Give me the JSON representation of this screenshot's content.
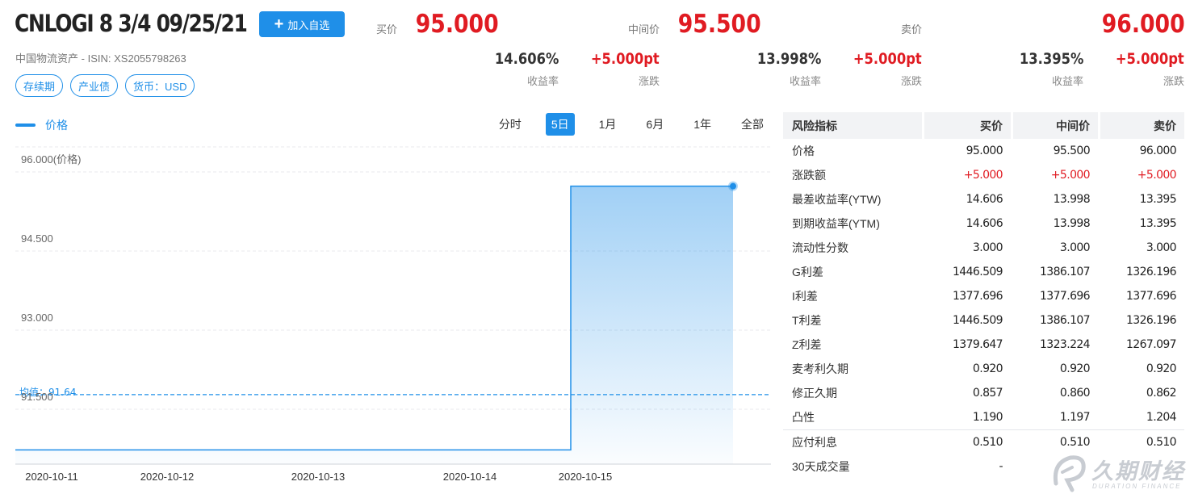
{
  "header": {
    "bond_name": "CNLOGI 8 3/4 09/25/21",
    "add_button_label": "加入自选",
    "issuer": "中国物流资产",
    "isin_label": "ISIN:",
    "isin": "XS2055798263",
    "tags": [
      "存续期",
      "产业债",
      "货币：USD"
    ]
  },
  "quotes": [
    {
      "label": "买价",
      "price": "95.000",
      "yield": "14.606%",
      "yield_label": "收益率",
      "change": "+5.000pt",
      "change_label": "涨跌"
    },
    {
      "label": "中间价",
      "price": "95.500",
      "yield": "13.998%",
      "yield_label": "收益率",
      "change": "+5.000pt",
      "change_label": "涨跌"
    },
    {
      "label": "卖价",
      "price": "96.000",
      "yield": "13.395%",
      "yield_label": "收益率",
      "change": "+5.000pt",
      "change_label": "涨跌"
    }
  ],
  "chart_controls": {
    "legend_label": "价格",
    "periods": [
      "分时",
      "5日",
      "1月",
      "6月",
      "1年",
      "全部"
    ],
    "active_period": "5日"
  },
  "chart_data": {
    "type": "area",
    "series": [
      {
        "name": "价格",
        "x": [
          "2020-10-11",
          "2020-10-12",
          "2020-10-13",
          "2020-10-14",
          "2020-10-15",
          "2020-10-15",
          "2020-10-16"
        ],
        "values": [
          90.5,
          90.5,
          90.5,
          90.5,
          90.5,
          95.5,
          95.5
        ]
      }
    ],
    "x_tick_labels": [
      "2020-10-11",
      "2020-10-12",
      "2020-10-13",
      "2020-10-14",
      "2020-10-15"
    ],
    "y_tick_labels": [
      "96.000(价格)",
      "94.500",
      "93.000",
      "91.500"
    ],
    "y_ticks": [
      96.0,
      94.5,
      93.0,
      91.5
    ],
    "average": {
      "label": "均值：91.64",
      "value": 91.64
    },
    "grid": true,
    "color": "#1f8fe8"
  },
  "risk_table": {
    "headers": [
      "风险指标",
      "买价",
      "中间价",
      "卖价"
    ],
    "rows": [
      {
        "name": "价格",
        "values": [
          "95.000",
          "95.500",
          "96.000"
        ]
      },
      {
        "name": "涨跌额",
        "values": [
          "+5.000",
          "+5.000",
          "+5.000"
        ]
      },
      {
        "name": "最差收益率(YTW)",
        "values": [
          "14.606",
          "13.998",
          "13.395"
        ]
      },
      {
        "name": "到期收益率(YTM)",
        "values": [
          "14.606",
          "13.998",
          "13.395"
        ]
      },
      {
        "name": "流动性分数",
        "values": [
          "3.000",
          "3.000",
          "3.000"
        ]
      },
      {
        "name": "G利差",
        "values": [
          "1446.509",
          "1386.107",
          "1326.196"
        ]
      },
      {
        "name": "I利差",
        "values": [
          "1377.696",
          "1377.696",
          "1377.696"
        ]
      },
      {
        "name": "T利差",
        "values": [
          "1446.509",
          "1386.107",
          "1326.196"
        ]
      },
      {
        "name": "Z利差",
        "values": [
          "1379.647",
          "1323.224",
          "1267.097"
        ]
      },
      {
        "name": "麦考利久期",
        "values": [
          "0.920",
          "0.920",
          "0.920"
        ]
      },
      {
        "name": "修正久期",
        "values": [
          "0.857",
          "0.860",
          "0.862"
        ]
      },
      {
        "name": "凸性",
        "values": [
          "1.190",
          "1.197",
          "1.204"
        ]
      },
      {
        "name": "应付利息",
        "values": [
          "0.510",
          "0.510",
          "0.510"
        ]
      },
      {
        "name": "30天成交量",
        "values": [
          "-",
          "",
          ""
        ]
      }
    ]
  },
  "watermark": {
    "main": "久期财经",
    "sub": "DURATION FINANCE"
  },
  "colors": {
    "accent": "#1f8fe8",
    "up": "#e01b22"
  }
}
